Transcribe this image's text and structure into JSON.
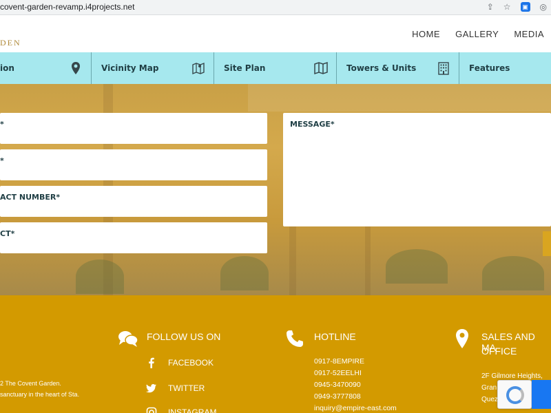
{
  "browser": {
    "url": "covent-garden-revamp.i4projects.net",
    "icons": [
      "share-icon",
      "star-icon",
      "extension-icon",
      "camera-icon"
    ]
  },
  "header": {
    "logo_fragment": "DEN",
    "nav": [
      "HOME",
      "GALLERY",
      "MEDIA"
    ]
  },
  "subnav": {
    "items": [
      {
        "label": "ion",
        "icon": "map-pin-icon"
      },
      {
        "label": "Vicinity Map",
        "icon": "map-icon"
      },
      {
        "label": "Site Plan",
        "icon": "folded-map-icon"
      },
      {
        "label": "Towers & Units",
        "icon": "building-icon"
      },
      {
        "label": "Features",
        "icon": ""
      }
    ]
  },
  "form": {
    "name_label": "*",
    "email_label": "*",
    "contact_label": "ACT NUMBER*",
    "subject_label": "CT*",
    "message_label": "MESSAGE*"
  },
  "footer": {
    "copyright_line1": "2 The Covent Garden.",
    "copyright_line2": "sanctuary in the heart of Sta.",
    "follow_heading": "FOLLOW US ON",
    "social": [
      "FACEBOOK",
      "TWITTER",
      "INSTAGRAM"
    ],
    "hotline_heading": "HOTLINE",
    "hotlines": [
      "0917-8EMPIRE",
      "0917-52EELHI",
      "0945-3470090",
      "0949-3777808",
      "inquiry@empire-east.com"
    ],
    "sales_heading_line1": "SALES AND MA",
    "sales_heading_line2": "OFFICE",
    "address_line1": "2F Gilmore Heights,",
    "address_line2": "Gran",
    "address_line3": "Quez"
  },
  "colors": {
    "subnav_bg": "#a6e8ee",
    "footer_bg": "#d39a00",
    "label_text": "#1f3e44"
  }
}
